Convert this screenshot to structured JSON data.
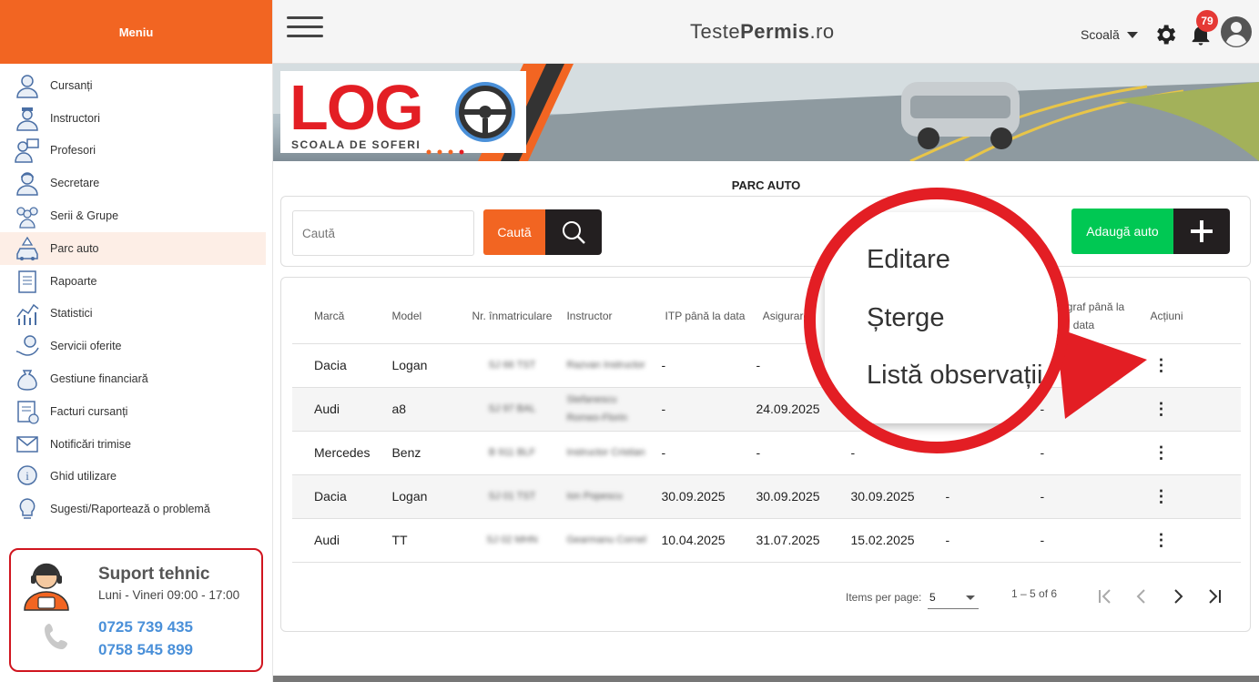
{
  "sidebar": {
    "title": "Meniu",
    "items": [
      {
        "label": "Cursanți",
        "icon": "student-icon"
      },
      {
        "label": "Instructori",
        "icon": "instructor-icon"
      },
      {
        "label": "Profesori",
        "icon": "teacher-icon"
      },
      {
        "label": "Secretare",
        "icon": "secretary-icon"
      },
      {
        "label": "Serii & Grupe",
        "icon": "group-icon"
      },
      {
        "label": "Parc auto",
        "icon": "car-icon",
        "active": true
      },
      {
        "label": "Rapoarte",
        "icon": "report-icon"
      },
      {
        "label": "Statistici",
        "icon": "chart-icon"
      },
      {
        "label": "Servicii oferite",
        "icon": "service-icon"
      },
      {
        "label": "Gestiune financiară",
        "icon": "money-bag-icon"
      },
      {
        "label": "Facturi cursanți",
        "icon": "invoice-icon"
      },
      {
        "label": "Notificări trimise",
        "icon": "mail-icon"
      },
      {
        "label": "Ghid utilizare",
        "icon": "info-icon"
      },
      {
        "label": "Sugesti/Raportează o problemă",
        "icon": "lightbulb-icon"
      }
    ],
    "support": {
      "title": "Suport tehnic",
      "hours": "Luni - Vineri 09:00 - 17:00",
      "phone1": "0725 739 435",
      "phone2": "0758 545 899"
    }
  },
  "header": {
    "brand_light": "Teste",
    "brand_bold": "Permis",
    "brand_suffix": ".ro",
    "role": "Scoală",
    "notification_count": "79"
  },
  "banner": {
    "logo_text": "LOG",
    "logo_subtitle": "SCOALA DE SOFERI"
  },
  "page": {
    "title": "PARC AUTO",
    "search_placeholder": "Caută",
    "search_button": "Caută",
    "add_button": "Adaugă auto"
  },
  "table": {
    "headers": [
      "Marcă",
      "Model",
      "Nr. înmatriculare",
      "Instructor",
      "ITP până la data",
      "Asigurare până",
      "",
      "",
      "Tahograf până la data",
      "Acțiuni"
    ],
    "rows": [
      {
        "marca": "Dacia",
        "model": "Logan",
        "nr": "SJ 66 TST",
        "instructor": "Razvan Instructor",
        "itp": "-",
        "asig": "-",
        "c7": "",
        "c8": "",
        "tah": "",
        "shaded": false
      },
      {
        "marca": "Audi",
        "model": "a8",
        "nr": "SJ 97 BAL",
        "instructor": "Stefanescu Romeo-Florin",
        "itp": "-",
        "asig": "24.09.2025",
        "c7": "",
        "c8": "",
        "tah": "-",
        "shaded": true
      },
      {
        "marca": "Mercedes",
        "model": "Benz",
        "nr": "B 911 BLF",
        "instructor": "Instructor Cristian",
        "itp": "-",
        "asig": "-",
        "c7": "-",
        "c8": "",
        "tah": "-",
        "shaded": false
      },
      {
        "marca": "Dacia",
        "model": "Logan",
        "nr": "SJ 01 TST",
        "instructor": "Ion Popescu",
        "itp": "30.09.2025",
        "asig": "30.09.2025",
        "c7": "30.09.2025",
        "c8": "-",
        "tah": "-",
        "shaded": true
      },
      {
        "marca": "Audi",
        "model": "TT",
        "nr": "SJ 02 MHN",
        "instructor": "Gearmanu Cornel",
        "itp": "10.04.2025",
        "asig": "31.07.2025",
        "c7": "15.02.2025",
        "c8": "-",
        "tah": "-",
        "shaded": false
      }
    ]
  },
  "paginator": {
    "items_per_page_label": "Items per page:",
    "items_per_page": "5",
    "range": "1 – 5 of 6"
  },
  "callout_menu": {
    "items": [
      "Editare",
      "Șterge",
      "Listă observații"
    ]
  },
  "colors": {
    "accent": "#f26522",
    "add": "#00c853",
    "callout": "#e31e24",
    "dark": "#231f20"
  }
}
